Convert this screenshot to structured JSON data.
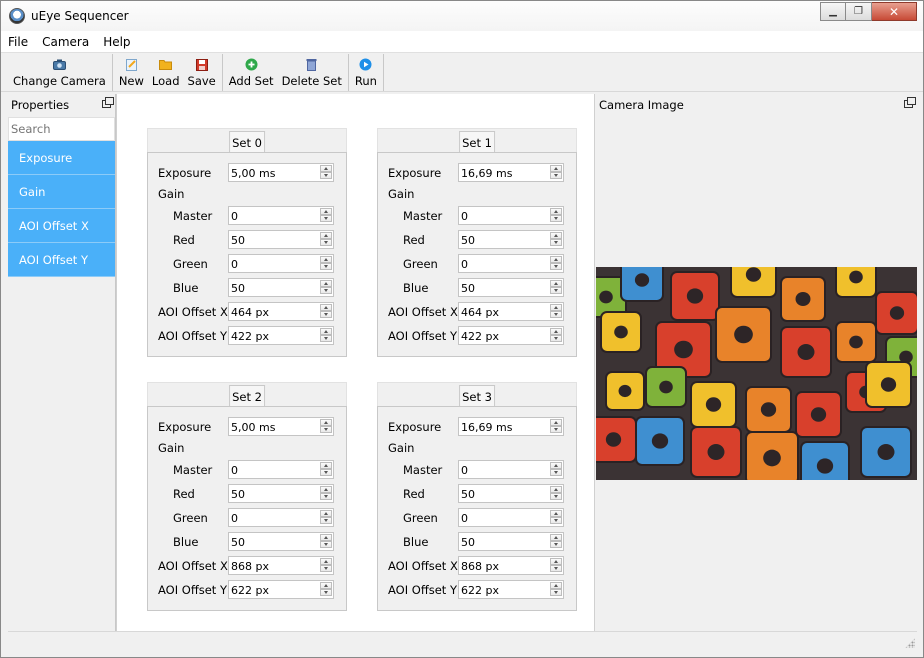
{
  "window": {
    "title": "uEye Sequencer",
    "buttons": {
      "minimize": "minimize-icon",
      "maximize": "restore-icon",
      "close": "close-icon"
    }
  },
  "menu": [
    "File",
    "Camera",
    "Help"
  ],
  "toolbar": {
    "change_camera": "Change Camera",
    "new": "New",
    "load": "Load",
    "save": "Save",
    "add_set": "Add Set",
    "delete_set": "Delete Set",
    "run": "Run"
  },
  "properties_panel": {
    "title": "Properties",
    "search_placeholder": "Search",
    "items": [
      "Exposure",
      "Gain",
      "AOI Offset X",
      "AOI Offset Y"
    ]
  },
  "labels": {
    "exposure": "Exposure",
    "gain": "Gain",
    "master": "Master",
    "red": "Red",
    "green": "Green",
    "blue": "Blue",
    "aoi_x": "AOI Offset X",
    "aoi_y": "AOI Offset Y"
  },
  "sets": [
    {
      "name": "Set 0",
      "exposure": "5,00 ms",
      "master": "0",
      "red": "50",
      "green": "0",
      "blue": "50",
      "aoi_x": "464 px",
      "aoi_y": "422 px"
    },
    {
      "name": "Set 1",
      "exposure": "16,69 ms",
      "master": "0",
      "red": "50",
      "green": "0",
      "blue": "50",
      "aoi_x": "464 px",
      "aoi_y": "422 px"
    },
    {
      "name": "Set 2",
      "exposure": "5,00 ms",
      "master": "0",
      "red": "50",
      "green": "0",
      "blue": "50",
      "aoi_x": "868 px",
      "aoi_y": "622 px"
    },
    {
      "name": "Set 3",
      "exposure": "16,69 ms",
      "master": "0",
      "red": "50",
      "green": "0",
      "blue": "50",
      "aoi_x": "868 px",
      "aoi_y": "622 px"
    }
  ],
  "camera_panel": {
    "title": "Camera Image"
  },
  "colors": {
    "selected_item": "#4ab0f9",
    "add_icon": "#2fa84a",
    "run_icon": "#1e8fe8",
    "save_icon": "#d23a2a",
    "load_icon": "#f2b21d"
  }
}
